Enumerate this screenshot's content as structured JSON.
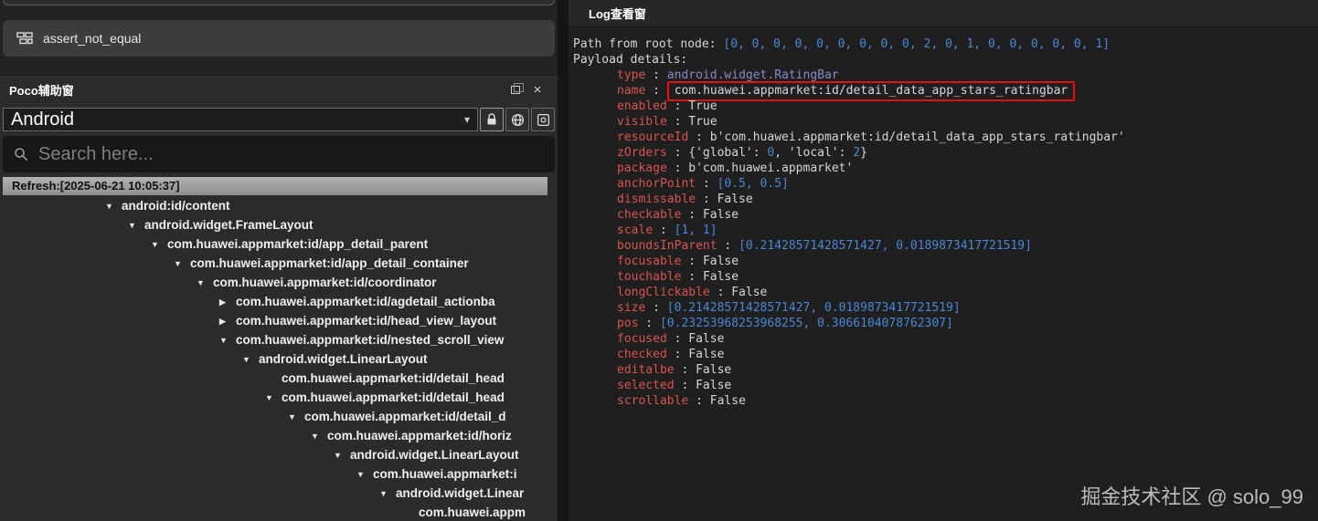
{
  "colors": {
    "highlight_box": "#e01212",
    "key": "#d9544d",
    "number": "#4a86d8",
    "string_value": "#8888c8",
    "tree_text": "#efefef"
  },
  "icons": {
    "close": "×",
    "dropdown": "▾",
    "expanded": "▼",
    "collapsed": "▶"
  },
  "script_block": {
    "label": "assert_not_equal"
  },
  "poco_panel": {
    "title": "Poco辅助窗",
    "device_selector": {
      "value": "Android"
    },
    "search": {
      "placeholder": "Search here..."
    },
    "refresh_label": "Refresh:[2025-06-21 10:05:37]"
  },
  "tree": {
    "base_indent": 115,
    "indent_step": 25,
    "items": [
      {
        "depth": 0,
        "arrow": "down",
        "label": "android:id/content"
      },
      {
        "depth": 1,
        "arrow": "down",
        "label": "android.widget.FrameLayout"
      },
      {
        "depth": 2,
        "arrow": "down",
        "label": "com.huawei.appmarket:id/app_detail_parent"
      },
      {
        "depth": 3,
        "arrow": "down",
        "label": "com.huawei.appmarket:id/app_detail_container"
      },
      {
        "depth": 4,
        "arrow": "down",
        "label": "com.huawei.appmarket:id/coordinator"
      },
      {
        "depth": 5,
        "arrow": "right",
        "label": "com.huawei.appmarket:id/agdetail_actionba"
      },
      {
        "depth": 5,
        "arrow": "right",
        "label": "com.huawei.appmarket:id/head_view_layout"
      },
      {
        "depth": 5,
        "arrow": "down",
        "label": "com.huawei.appmarket:id/nested_scroll_view"
      },
      {
        "depth": 6,
        "arrow": "down",
        "label": "android.widget.LinearLayout"
      },
      {
        "depth": 7,
        "arrow": "none",
        "label": "com.huawei.appmarket:id/detail_head"
      },
      {
        "depth": 7,
        "arrow": "down",
        "label": "com.huawei.appmarket:id/detail_head"
      },
      {
        "depth": 8,
        "arrow": "down",
        "label": "com.huawei.appmarket:id/detail_d"
      },
      {
        "depth": 9,
        "arrow": "down",
        "label": "com.huawei.appmarket:id/horiz"
      },
      {
        "depth": 10,
        "arrow": "down",
        "label": "android.widget.LinearLayout"
      },
      {
        "depth": 11,
        "arrow": "down",
        "label": "com.huawei.appmarket:i"
      },
      {
        "depth": 12,
        "arrow": "down",
        "label": "android.widget.Linear"
      },
      {
        "depth": 13,
        "arrow": "none",
        "label": "com.huawei.appm"
      }
    ]
  },
  "log": {
    "title": "Log查看窗",
    "intro": [
      {
        "segments": [
          {
            "t": "Path from root node: ",
            "c": "plain"
          },
          {
            "t": "[0, 0, 0, 0, 0, 0, 0, 0, 0, 2, 0, 1, 0, 0, 0, 0, 0, 1]",
            "c": "num"
          }
        ]
      },
      {
        "segments": [
          {
            "t": "Payload details:",
            "c": "plain"
          }
        ]
      }
    ],
    "payload": [
      {
        "key": "type",
        "segments": [
          {
            "t": "android.widget.RatingBar",
            "c": "str"
          }
        ]
      },
      {
        "key": "name",
        "boxed": true,
        "segments": [
          {
            "t": "com.huawei.appmarket:id/detail_data_app_stars_ratingbar",
            "c": "plain"
          }
        ]
      },
      {
        "key": "enabled",
        "segments": [
          {
            "t": "True",
            "c": "plain"
          }
        ]
      },
      {
        "key": "visible",
        "segments": [
          {
            "t": "True",
            "c": "plain"
          }
        ]
      },
      {
        "key": "resourceId",
        "segments": [
          {
            "t": "b'com.huawei.appmarket:id/detail_data_app_stars_ratingbar'",
            "c": "plain"
          }
        ]
      },
      {
        "key": "zOrders",
        "segments": [
          {
            "t": "{'global': ",
            "c": "plain"
          },
          {
            "t": "0",
            "c": "num"
          },
          {
            "t": ", 'local': ",
            "c": "plain"
          },
          {
            "t": "2",
            "c": "num"
          },
          {
            "t": "}",
            "c": "plain"
          }
        ]
      },
      {
        "key": "package",
        "segments": [
          {
            "t": "b'com.huawei.appmarket'",
            "c": "plain"
          }
        ]
      },
      {
        "key": "anchorPoint",
        "segments": [
          {
            "t": "[0.5, 0.5]",
            "c": "num"
          }
        ]
      },
      {
        "key": "dismissable",
        "segments": [
          {
            "t": "False",
            "c": "plain"
          }
        ]
      },
      {
        "key": "checkable",
        "segments": [
          {
            "t": "False",
            "c": "plain"
          }
        ]
      },
      {
        "key": "scale",
        "segments": [
          {
            "t": "[1, 1]",
            "c": "num"
          }
        ]
      },
      {
        "key": "boundsInParent",
        "segments": [
          {
            "t": "[0.21428571428571427, 0.0189873417721519]",
            "c": "num"
          }
        ]
      },
      {
        "key": "focusable",
        "segments": [
          {
            "t": "False",
            "c": "plain"
          }
        ]
      },
      {
        "key": "touchable",
        "segments": [
          {
            "t": "False",
            "c": "plain"
          }
        ]
      },
      {
        "key": "longClickable",
        "segments": [
          {
            "t": "False",
            "c": "plain"
          }
        ]
      },
      {
        "key": "size",
        "segments": [
          {
            "t": "[0.21428571428571427, 0.0189873417721519]",
            "c": "num"
          }
        ]
      },
      {
        "key": "pos",
        "segments": [
          {
            "t": "[0.23253968253968255, 0.3066104078762307]",
            "c": "num"
          }
        ]
      },
      {
        "key": "focused",
        "segments": [
          {
            "t": "False",
            "c": "plain"
          }
        ]
      },
      {
        "key": "checked",
        "segments": [
          {
            "t": "False",
            "c": "plain"
          }
        ]
      },
      {
        "key": "editalbe",
        "segments": [
          {
            "t": "False",
            "c": "plain"
          }
        ]
      },
      {
        "key": "selected",
        "segments": [
          {
            "t": "False",
            "c": "plain"
          }
        ]
      },
      {
        "key": "scrollable",
        "segments": [
          {
            "t": "False",
            "c": "plain"
          }
        ]
      }
    ]
  },
  "watermark": "掘金技术社区 @ solo_99"
}
